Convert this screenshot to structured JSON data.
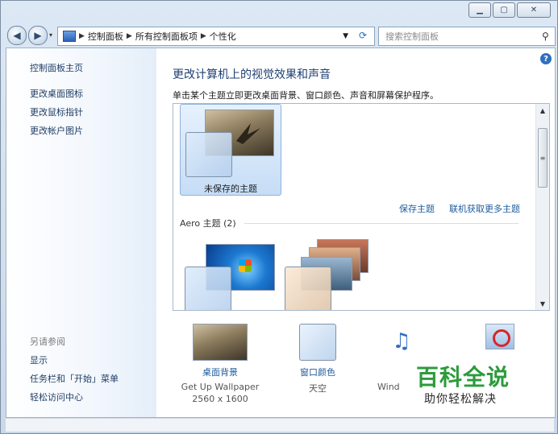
{
  "window": {
    "min_icon": "minimize-icon",
    "max_icon": "maximize-icon",
    "close_icon": "close-icon"
  },
  "address": {
    "crumbs": [
      "控制面板",
      "所有控制面板项",
      "个性化"
    ],
    "search_placeholder": "搜索控制面板"
  },
  "sidebar": {
    "home": "控制面板主页",
    "links": [
      "更改桌面图标",
      "更改鼠标指针",
      "更改帐户图片"
    ],
    "see_also_heading": "另请参阅",
    "see_also": [
      "显示",
      "任务栏和「开始」菜单",
      "轻松访问中心"
    ]
  },
  "main": {
    "title": "更改计算机上的视觉效果和声音",
    "description": "单击某个主题立即更改桌面背景、窗口颜色、声音和屏幕保护程序。",
    "unsaved_theme": "未保存的主题",
    "save_theme": "保存主题",
    "get_more": "联机获取更多主题",
    "aero_group": "Aero 主题 (2)"
  },
  "bottom": {
    "background_label": "桌面背景",
    "background_name": "Get Up Wallpaper",
    "background_res": "2560 x 1600",
    "color_label": "窗口颜色",
    "color_name": "天空",
    "sound_name": "Wind"
  },
  "watermark": {
    "brand": "百科全说",
    "tagline": "助你轻松解决"
  }
}
